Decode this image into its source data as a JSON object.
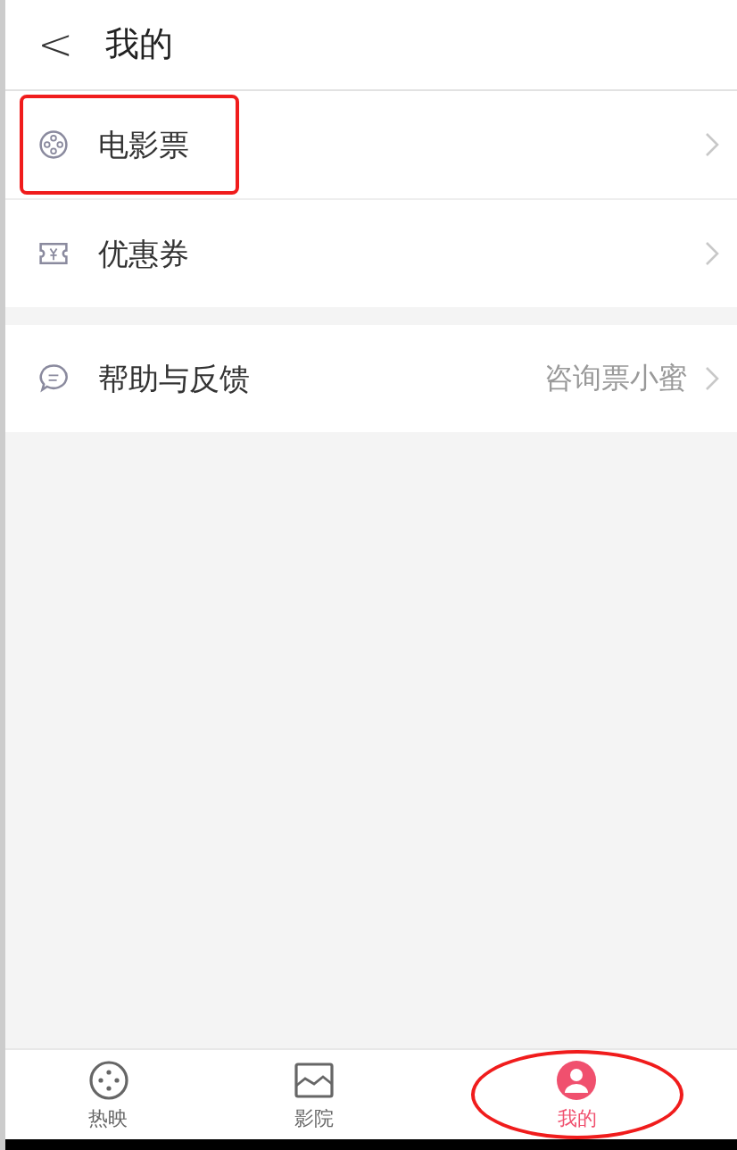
{
  "header": {
    "back": "<",
    "title": "我的"
  },
  "groups": [
    [
      {
        "kind": "film",
        "label": "电影票",
        "highlighted": true
      },
      {
        "kind": "coupon",
        "label": "优惠券",
        "highlighted": false
      }
    ],
    [
      {
        "kind": "chat",
        "label": "帮助与反馈",
        "value": "咨询票小蜜",
        "highlighted": false
      }
    ]
  ],
  "tabs": [
    {
      "kind": "film",
      "label": "热映",
      "selected": false,
      "highlighted": false
    },
    {
      "kind": "picture",
      "label": "影院",
      "selected": false,
      "highlighted": false
    },
    {
      "kind": "user",
      "label": "我的",
      "selected": true,
      "highlighted": true
    }
  ]
}
